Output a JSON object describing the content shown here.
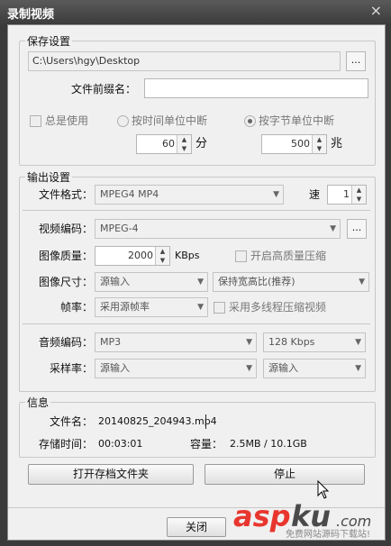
{
  "window": {
    "title": "录制视频",
    "close_glyph": "×"
  },
  "save": {
    "legend": "保存设置",
    "path": "C:\\Users\\hgy\\Desktop",
    "browse": "...",
    "prefix_label": "文件前缀名：",
    "prefix_value": "",
    "always_use": "总是使用",
    "by_time": "按时间单位中断",
    "by_bytes": "按字节单位中断",
    "time_value": "60",
    "time_unit": "分",
    "bytes_value": "500",
    "bytes_unit": "兆"
  },
  "output": {
    "legend": "输出设置",
    "format_label": "文件格式：",
    "format_value": "MPEG4 MP4",
    "speed_label": "速",
    "speed_value": "1",
    "video_codec_label": "视频编码：",
    "video_codec_value": "MPEG-4",
    "video_codec_btn": "...",
    "quality_label": "图像质量：",
    "quality_value": "2000",
    "quality_unit": "KBps",
    "hq_label": "开启高质量压缩",
    "size_label": "图像尺寸：",
    "size_value": "源输入",
    "aspect_value": "保持宽高比(推荐)",
    "fps_label": "帧率：",
    "fps_value": "采用源帧率",
    "mt_label": "采用多线程压缩视频",
    "audio_codec_label": "音频编码：",
    "audio_codec_value": "MP3",
    "audio_bitrate_value": "128 Kbps",
    "sample_label": "采样率：",
    "sample_value": "源输入",
    "channel_value": "源输入"
  },
  "info": {
    "legend": "信息",
    "filename_label": "文件名：",
    "filename_value": "20140825_204943.mp4",
    "time_label": "存储时间：",
    "time_value": "00:03:01",
    "capacity_label": "容量：",
    "capacity_value": "2.5MB / 10.1GB"
  },
  "buttons": {
    "open_folder": "打开存档文件夹",
    "stop": "停止",
    "close": "关闭"
  },
  "watermark": {
    "logo": "aspku.com",
    "tagline": "免费网站源码下载站!"
  }
}
